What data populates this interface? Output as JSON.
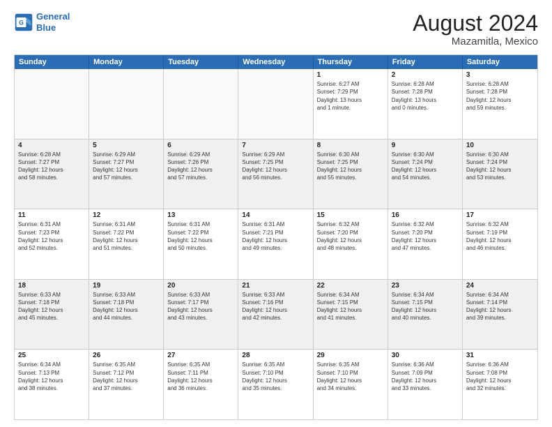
{
  "header": {
    "logo_line1": "General",
    "logo_line2": "Blue",
    "main_title": "August 2024",
    "subtitle": "Mazamitla, Mexico"
  },
  "calendar": {
    "days_of_week": [
      "Sunday",
      "Monday",
      "Tuesday",
      "Wednesday",
      "Thursday",
      "Friday",
      "Saturday"
    ],
    "weeks": [
      [
        {
          "day": "",
          "info": "",
          "empty": true
        },
        {
          "day": "",
          "info": "",
          "empty": true
        },
        {
          "day": "",
          "info": "",
          "empty": true
        },
        {
          "day": "",
          "info": "",
          "empty": true
        },
        {
          "day": "1",
          "info": "Sunrise: 6:27 AM\nSunset: 7:29 PM\nDaylight: 13 hours\nand 1 minute."
        },
        {
          "day": "2",
          "info": "Sunrise: 6:28 AM\nSunset: 7:28 PM\nDaylight: 13 hours\nand 0 minutes."
        },
        {
          "day": "3",
          "info": "Sunrise: 6:28 AM\nSunset: 7:28 PM\nDaylight: 12 hours\nand 59 minutes."
        }
      ],
      [
        {
          "day": "4",
          "info": "Sunrise: 6:28 AM\nSunset: 7:27 PM\nDaylight: 12 hours\nand 58 minutes."
        },
        {
          "day": "5",
          "info": "Sunrise: 6:29 AM\nSunset: 7:27 PM\nDaylight: 12 hours\nand 57 minutes."
        },
        {
          "day": "6",
          "info": "Sunrise: 6:29 AM\nSunset: 7:26 PM\nDaylight: 12 hours\nand 57 minutes."
        },
        {
          "day": "7",
          "info": "Sunrise: 6:29 AM\nSunset: 7:25 PM\nDaylight: 12 hours\nand 56 minutes."
        },
        {
          "day": "8",
          "info": "Sunrise: 6:30 AM\nSunset: 7:25 PM\nDaylight: 12 hours\nand 55 minutes."
        },
        {
          "day": "9",
          "info": "Sunrise: 6:30 AM\nSunset: 7:24 PM\nDaylight: 12 hours\nand 54 minutes."
        },
        {
          "day": "10",
          "info": "Sunrise: 6:30 AM\nSunset: 7:24 PM\nDaylight: 12 hours\nand 53 minutes."
        }
      ],
      [
        {
          "day": "11",
          "info": "Sunrise: 6:31 AM\nSunset: 7:23 PM\nDaylight: 12 hours\nand 52 minutes."
        },
        {
          "day": "12",
          "info": "Sunrise: 6:31 AM\nSunset: 7:22 PM\nDaylight: 12 hours\nand 51 minutes."
        },
        {
          "day": "13",
          "info": "Sunrise: 6:31 AM\nSunset: 7:22 PM\nDaylight: 12 hours\nand 50 minutes."
        },
        {
          "day": "14",
          "info": "Sunrise: 6:31 AM\nSunset: 7:21 PM\nDaylight: 12 hours\nand 49 minutes."
        },
        {
          "day": "15",
          "info": "Sunrise: 6:32 AM\nSunset: 7:20 PM\nDaylight: 12 hours\nand 48 minutes."
        },
        {
          "day": "16",
          "info": "Sunrise: 6:32 AM\nSunset: 7:20 PM\nDaylight: 12 hours\nand 47 minutes."
        },
        {
          "day": "17",
          "info": "Sunrise: 6:32 AM\nSunset: 7:19 PM\nDaylight: 12 hours\nand 46 minutes."
        }
      ],
      [
        {
          "day": "18",
          "info": "Sunrise: 6:33 AM\nSunset: 7:18 PM\nDaylight: 12 hours\nand 45 minutes."
        },
        {
          "day": "19",
          "info": "Sunrise: 6:33 AM\nSunset: 7:18 PM\nDaylight: 12 hours\nand 44 minutes."
        },
        {
          "day": "20",
          "info": "Sunrise: 6:33 AM\nSunset: 7:17 PM\nDaylight: 12 hours\nand 43 minutes."
        },
        {
          "day": "21",
          "info": "Sunrise: 6:33 AM\nSunset: 7:16 PM\nDaylight: 12 hours\nand 42 minutes."
        },
        {
          "day": "22",
          "info": "Sunrise: 6:34 AM\nSunset: 7:15 PM\nDaylight: 12 hours\nand 41 minutes."
        },
        {
          "day": "23",
          "info": "Sunrise: 6:34 AM\nSunset: 7:15 PM\nDaylight: 12 hours\nand 40 minutes."
        },
        {
          "day": "24",
          "info": "Sunrise: 6:34 AM\nSunset: 7:14 PM\nDaylight: 12 hours\nand 39 minutes."
        }
      ],
      [
        {
          "day": "25",
          "info": "Sunrise: 6:34 AM\nSunset: 7:13 PM\nDaylight: 12 hours\nand 38 minutes."
        },
        {
          "day": "26",
          "info": "Sunrise: 6:35 AM\nSunset: 7:12 PM\nDaylight: 12 hours\nand 37 minutes."
        },
        {
          "day": "27",
          "info": "Sunrise: 6:35 AM\nSunset: 7:11 PM\nDaylight: 12 hours\nand 36 minutes."
        },
        {
          "day": "28",
          "info": "Sunrise: 6:35 AM\nSunset: 7:10 PM\nDaylight: 12 hours\nand 35 minutes."
        },
        {
          "day": "29",
          "info": "Sunrise: 6:35 AM\nSunset: 7:10 PM\nDaylight: 12 hours\nand 34 minutes."
        },
        {
          "day": "30",
          "info": "Sunrise: 6:36 AM\nSunset: 7:09 PM\nDaylight: 12 hours\nand 33 minutes."
        },
        {
          "day": "31",
          "info": "Sunrise: 6:36 AM\nSunset: 7:08 PM\nDaylight: 12 hours\nand 32 minutes."
        }
      ]
    ]
  }
}
